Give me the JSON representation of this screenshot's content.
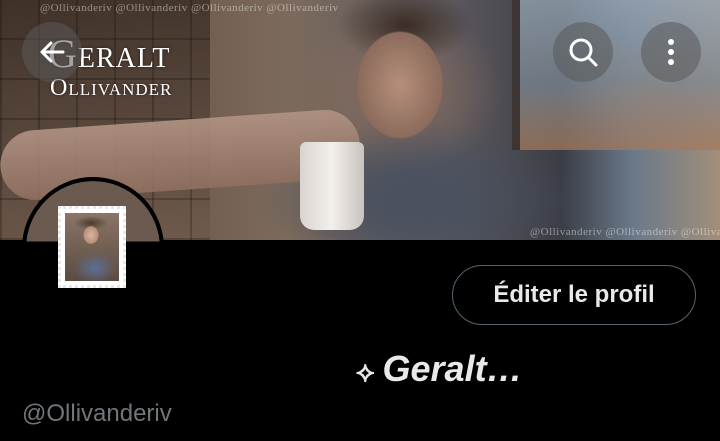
{
  "banner": {
    "title_first": "Geralt",
    "title_last": "Ollivander",
    "watermark": "@Ollivanderiv @Ollivanderiv @Ollivanderiv @Ollivanderiv"
  },
  "toolbar": {
    "back_icon": "arrow-left-icon",
    "search_icon": "search-icon",
    "more_icon": "more-vertical-icon"
  },
  "profile": {
    "edit_button_label": "Éditer le profil",
    "display_name_prefix": "⟡",
    "display_name": "Geralt…",
    "handle": "@Ollivanderiv"
  },
  "colors": {
    "background": "#000000",
    "primary_text": "#e7e9ea",
    "secondary_text": "#71767b",
    "button_border": "#536471"
  }
}
